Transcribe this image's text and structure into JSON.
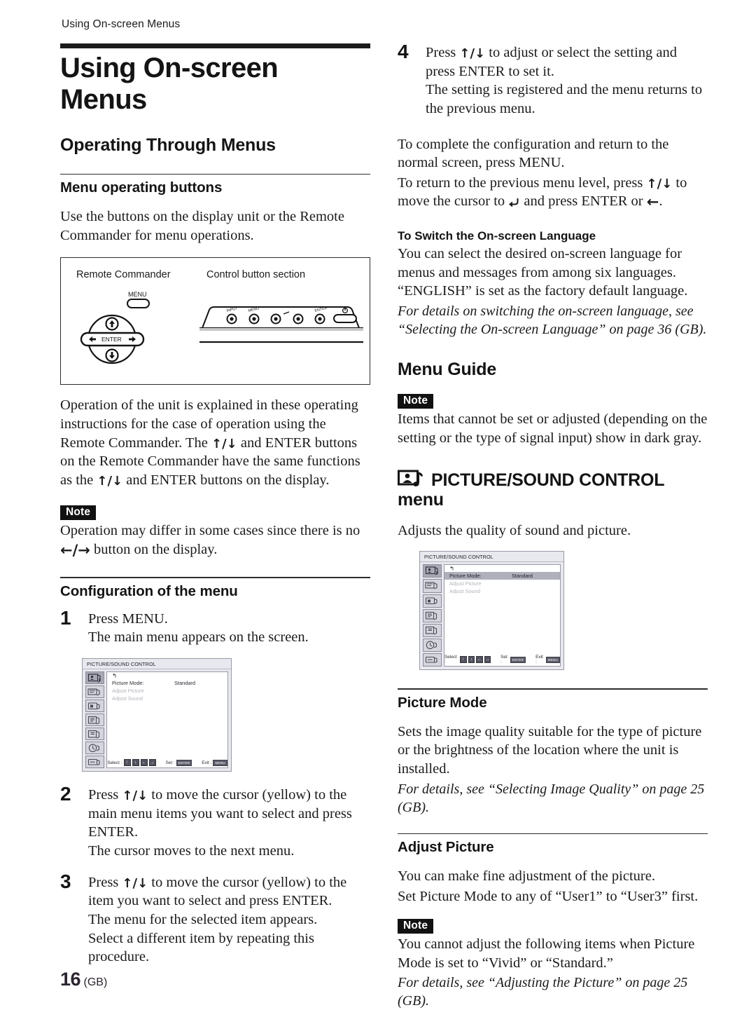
{
  "running_head": "Using On-screen Menus",
  "chapter_title": "Using On-screen Menus",
  "left": {
    "section_title": "Operating Through Menus",
    "sub1": "Menu operating buttons",
    "para1": "Use the buttons on the display unit or the Remote Commander for menu operations.",
    "figure": {
      "caption_left": "Remote Commander",
      "caption_right": "Control button section",
      "remote": {
        "menu_label": "MENU",
        "enter_label": "ENTER"
      },
      "panel_labels": [
        "INPUT",
        "MENU",
        "ENTER"
      ]
    },
    "para2": "Operation of the unit is explained in these operating instructions for the case of operation using the Remote Commander. The ",
    "para2b": " and ENTER buttons on the Remote Commander have the same functions as the ",
    "para2c": " and ENTER buttons on the display.",
    "note_label": "Note",
    "note1a": "Operation may differ in some cases since there is no ",
    "note1b": " button on the display.",
    "sub2": "Configuration of the menu",
    "step1_num": "1",
    "step1_line1": "Press MENU.",
    "step1_line2": "The main menu appears on the screen.",
    "step2_num": "2",
    "step2_a": "Press ",
    "step2_b": " to move the cursor (yellow) to the main menu items you want to select and press ENTER.",
    "step2_c": "The cursor moves to the next menu.",
    "step3_num": "3",
    "step3_a": "Press ",
    "step3_b": " to move the cursor (yellow) to the item you want to select and press ENTER.",
    "step3_c": "The menu for the selected item appears.",
    "step3_d": "Select a different item by repeating this procedure."
  },
  "right": {
    "step4_num": "4",
    "step4_a": "Press ",
    "step4_b": " to adjust or select the setting and press ENTER to set it.",
    "step4_c": "The setting is registered and the menu returns to the previous menu.",
    "para_complete_1": "To complete the configuration and return to the normal screen, press MENU.",
    "para_complete_2a": "To return to the previous menu level, press ",
    "para_complete_2b": " to move the cursor to ",
    "para_complete_2c": " and press ENTER or ",
    "para_complete_2d": ".",
    "lang_head": "To Switch the On-screen Language",
    "lang_body": "You can select the desired on-screen language for menus and messages from among six languages. “ENGLISH” is set as the factory default language.",
    "lang_ital": "For details on switching the on-screen language, see “Selecting the On-screen Language” on page 36 (GB).",
    "menu_guide_title": "Menu Guide",
    "note_label": "Note",
    "note_guide": "Items that cannot be set or adjusted (depending on the setting or the type of signal input) show in dark gray.",
    "ps_menu_title": "PICTURE/SOUND CONTROL",
    "ps_menu_title2": "menu",
    "ps_menu_desc": "Adjusts the quality of sound and picture.",
    "picture_mode_head": "Picture Mode",
    "picture_mode_body": "Sets the image quality suitable for the type of picture or the brightness of the location where the unit is installed.",
    "picture_mode_ital": "For details, see “Selecting Image Quality” on page 25 (GB).",
    "adjust_picture_head": "Adjust Picture",
    "adjust_picture_body1": "You can make fine adjustment of the picture.",
    "adjust_picture_body2": "Set Picture Mode to any of “User1” to “User3” first.",
    "note_label2": "Note",
    "adjust_note1": "You cannot adjust the following items when Picture Mode is set to “Vivid” or “Standard.”",
    "adjust_note_ital": "For details, see “Adjusting the Picture” on page 25 (GB)."
  },
  "osd": {
    "title": "PICTURE/SOUND CONTROL",
    "back_glyph": "↰",
    "rows": [
      {
        "label": "Picture Mode:",
        "value": "Standard",
        "state": "normal"
      },
      {
        "label": "Adjust Picture",
        "value": "",
        "state": "dim"
      },
      {
        "label": "Adjust Sound",
        "value": "",
        "state": "dim"
      }
    ],
    "rows_selected": [
      {
        "label": "Picture Mode:",
        "value": "Standard",
        "state": "selected"
      },
      {
        "label": "Adjust Picture",
        "value": "",
        "state": "dim"
      },
      {
        "label": "Adjust Sound",
        "value": "",
        "state": "dim"
      }
    ],
    "footer": {
      "select_label": "Select :",
      "set_label": "Set :",
      "set_key": "ENTER",
      "exit_label": "Exit :",
      "exit_key": "MENU",
      "select_keys": [
        "↑",
        "↓",
        "←",
        "→"
      ]
    },
    "icon_count": 7
  },
  "arrows": {
    "up": "↑",
    "down": "↓",
    "left": "←",
    "right": "→",
    "up_down": "↑/↓",
    "left_right": "←/→"
  },
  "folio": {
    "number": "16",
    "suffix": "(GB)"
  },
  "colors": {
    "ink": "#1b1b1b",
    "note_bg": "#111111",
    "osd_bg": "#e8e8ef",
    "osd_sel": "#b0b0bd",
    "osd_dim": "#b3b3bd"
  }
}
